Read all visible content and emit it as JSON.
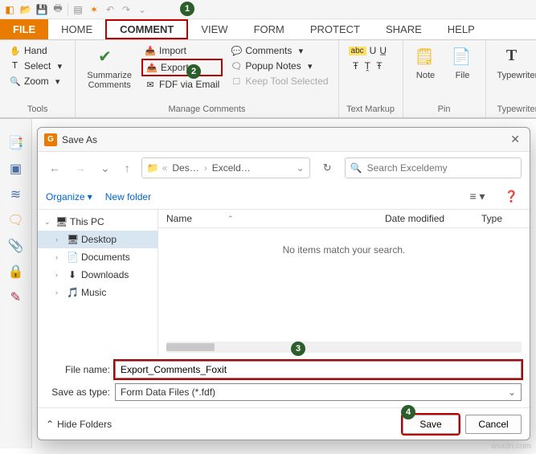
{
  "qat": {
    "dropdown": "⌄"
  },
  "tabs": {
    "file": "FILE",
    "home": "HOME",
    "comment": "COMMENT",
    "view": "VIEW",
    "form": "FORM",
    "protect": "PROTECT",
    "share": "SHARE",
    "help": "HELP"
  },
  "ribbon": {
    "tools": {
      "label": "Tools",
      "hand": "Hand",
      "select": "Select",
      "zoom": "Zoom"
    },
    "manage": {
      "label": "Manage Comments",
      "summarize": "Summarize\nComments",
      "import": "Import",
      "export": "Export",
      "fdf": "FDF via Email",
      "comments": "Comments",
      "popup": "Popup Notes",
      "keep": "Keep Tool Selected"
    },
    "textmarkup": {
      "label": "Text Markup"
    },
    "pin": {
      "label": "Pin",
      "note": "Note",
      "file": "File"
    },
    "typewriter": {
      "label": "Typewriter",
      "tw": "Typewriter"
    }
  },
  "dialog": {
    "title": "Save As",
    "breadcrumbs": [
      "Des…",
      "Exceld…"
    ],
    "search_placeholder": "Search Exceldemy",
    "organize": "Organize",
    "newfolder": "New folder",
    "tree": {
      "thispc": "This PC",
      "desktop": "Desktop",
      "documents": "Documents",
      "downloads": "Downloads",
      "music": "Music"
    },
    "columns": {
      "name": "Name",
      "date": "Date modified",
      "type": "Type"
    },
    "empty": "No items match your search.",
    "filename_label": "File name:",
    "filename_value": "Export_Comments_Foxit",
    "savetype_label": "Save as type:",
    "savetype_value": "Form Data Files (*.fdf)",
    "hidefolders": "Hide Folders",
    "save": "Save",
    "cancel": "Cancel"
  },
  "watermark": "wsxdn.com"
}
